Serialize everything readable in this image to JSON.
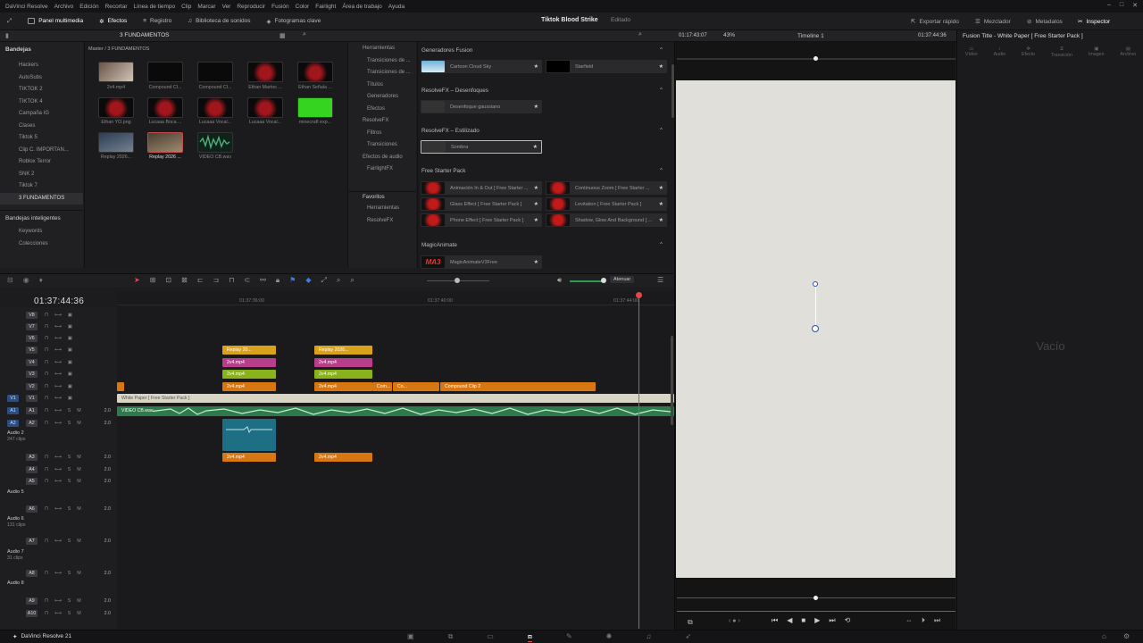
{
  "menubar": {
    "items": [
      "DaVinci Resolve",
      "Archivo",
      "Edición",
      "Recortar",
      "Línea de tiempo",
      "Clip",
      "Marcar",
      "Ver",
      "Reproducir",
      "Fusión",
      "Color",
      "Fairlight",
      "Área de trabajo",
      "Ayuda"
    ]
  },
  "toolbar": {
    "media_pool": "Panel multimedia",
    "effects": "Efectos",
    "index": "Registro",
    "sound_library": "Biblioteca de sonidos",
    "keyframes": "Fotogramas clave",
    "project_title": "Tiktok Blood Strike",
    "project_state": "Editado",
    "quick_export": "Exportar rápido",
    "mixer": "Mezclador",
    "metadata": "Metadatos",
    "inspector": "Inspector"
  },
  "subbar": {
    "breadcrumb": "3 FUNDAMENTOS",
    "zoom": "43%",
    "timeline_name": "Timeline 1",
    "timecode_left": "01:17:43:07",
    "timecode_right": "01:37:44:36"
  },
  "bins": {
    "title": "Bandejas",
    "items": [
      "Hackers",
      "AutoSubs",
      "TIKTOK 2",
      "TIKTOK 4",
      "Campaña IG",
      "Clases",
      "Tiktok 5",
      "Clip C. IMPORTAN...",
      "Roblox Terror",
      "SNK 2",
      "Tiktok 7",
      "3 FUNDAMENTOS"
    ],
    "smart_title": "Bandejas inteligentes",
    "smart_items": [
      "Keywords",
      "Colecciones"
    ]
  },
  "media": {
    "path": "Master / 3 FUNDAMENTOS",
    "clips": [
      "2v4.mp4",
      "Compound Cl...",
      "Compound Cl...",
      "Ethan Martos ...",
      "Ethan Señala ...",
      "Ethan YO.png",
      "Lucaaa Boca ...",
      "Lucaaa Vocal...",
      "Lucaaa Vocal...",
      "minecraft exp...",
      "Replay 2026...",
      "Replay 2026 ...",
      "VIDEO CB.wav"
    ]
  },
  "fxtree": {
    "items": [
      "Herramientas",
      "Transiciones de ...",
      "Transiciones de ...",
      "Títulos",
      "Generadores",
      "Efectos",
      "ResolveFX",
      "Filtros",
      "Transiciones",
      "Efectos de audio",
      "FairlightFX"
    ],
    "fav_title": "Favoritos",
    "fav_items": [
      "Herramientas",
      "ResolveFX"
    ]
  },
  "fxlist": {
    "sections": [
      "Generadores Fusion",
      "ResolveFX – Desenfoques",
      "ResolveFX – Estilizado",
      "Free Starter Pack",
      "MagicAnimate"
    ],
    "items": [
      "Cartoon Cloud Sky",
      "Starfield",
      "Desenfoque gaussiano",
      "Sombra",
      "Animación In & Out [ Free Starter ...",
      "Continuous Zoom [ Free Starter ...",
      "Glass Effect [ Free Starter Pack ]",
      "Levitation [ Free Starter Pack ]",
      "Phone Effect [ Free Starter Pack ]",
      "Shadow, Glow And Background [ ...",
      "MagicAnimateV3Free"
    ],
    "logo": "MA3"
  },
  "inspector": {
    "title": "Fusion Title - White Paper [ Free Starter Pack ]",
    "tabs": [
      "Vídeo",
      "Audio",
      "Efecto",
      "Transición",
      "Imagen",
      "Archivo"
    ],
    "empty": "Vacío"
  },
  "timeline": {
    "timecode": "01:37:44:36",
    "ruler": [
      "01:37:36:00",
      "01:37:40:00",
      "01:37:44:00"
    ],
    "attenuate": "Atenuar",
    "tracks": [
      {
        "label": "V8"
      },
      {
        "label": "V7"
      },
      {
        "label": "V6"
      },
      {
        "label": "V5"
      },
      {
        "label": "V4"
      },
      {
        "label": "V3"
      },
      {
        "label": "V2"
      },
      {
        "label": "V1",
        "src": "V1"
      },
      {
        "label": "A1",
        "src": "A1",
        "level": "2.0"
      },
      {
        "label": "A2",
        "src": "A2",
        "level": "2.0",
        "name": "Audio 2",
        "clips": "247 clips"
      },
      {
        "label": "A3",
        "level": "2.0"
      },
      {
        "label": "A4",
        "level": "2.0"
      },
      {
        "label": "A5",
        "level": "2.0",
        "name": "Audio 5"
      },
      {
        "label": "A6",
        "level": "2.0",
        "name": "Audio 6",
        "clips": "131 clips"
      },
      {
        "label": "A7",
        "level": "2.0",
        "name": "Audio 7",
        "clips": "31 clips"
      },
      {
        "label": "A8",
        "level": "2.0",
        "name": "Audio 8"
      },
      {
        "label": "A9",
        "level": "2.0"
      },
      {
        "label": "A10",
        "level": "2.0"
      }
    ],
    "clips": {
      "replay1": "Replay 20...",
      "replay2": "Replay 2026...",
      "v4a": "2v4.mp4",
      "v4b": "2v4.mp4",
      "v3a": "2v4.mp4",
      "v3b": "2v4.mp4",
      "v2a": "2v4.mp4",
      "v2b": "2v4.mp4",
      "com": "Com...",
      "co": "Co...",
      "compound": "Compound Clip 2",
      "whitepaper": "White Paper [ Free Starter Pack ]",
      "audio_main": "VIDEO CB.wav",
      "a3a": "2v4.mp4",
      "a3b": "2v4.mp4"
    }
  },
  "bottombar": {
    "app": "DaVinci Resolve 21"
  },
  "colors": {
    "accent": "#e64747",
    "clip_yellow": "#d9a21a",
    "clip_magenta": "#b83e8b",
    "clip_lime": "#8ab21c",
    "clip_orange": "#d77712",
    "clip_teal": "#1f6f84",
    "audio_green": "#2d7a4a",
    "paper": "#e0dfda"
  }
}
